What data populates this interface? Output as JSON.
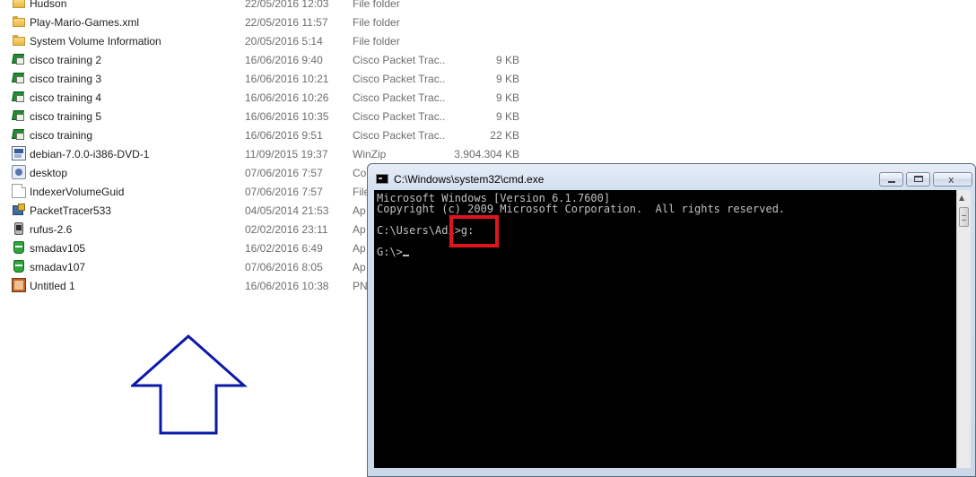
{
  "file_list": [
    {
      "name": "Hudson",
      "date": "22/05/2016 12:03",
      "type": "File folder",
      "size": "",
      "icon": "folder-icon"
    },
    {
      "name": "Play-Mario-Games.xml",
      "date": "22/05/2016 11:57",
      "type": "File folder",
      "size": "",
      "icon": "folder-icon"
    },
    {
      "name": "System Volume Information",
      "date": "20/05/2016 5:14",
      "type": "File folder",
      "size": "",
      "icon": "folder-icon"
    },
    {
      "name": "cisco training 2",
      "date": "16/06/2016 9:40",
      "type": "Cisco Packet Trac...",
      "size": "9 KB",
      "icon": "packet-tracer-file-icon"
    },
    {
      "name": "cisco training 3",
      "date": "16/06/2016 10:21",
      "type": "Cisco Packet Trac...",
      "size": "9 KB",
      "icon": "packet-tracer-file-icon"
    },
    {
      "name": "cisco training 4",
      "date": "16/06/2016 10:26",
      "type": "Cisco Packet Trac...",
      "size": "9 KB",
      "icon": "packet-tracer-file-icon"
    },
    {
      "name": "cisco training 5",
      "date": "16/06/2016 10:35",
      "type": "Cisco Packet Trac...",
      "size": "9 KB",
      "icon": "packet-tracer-file-icon"
    },
    {
      "name": "cisco training",
      "date": "16/06/2016 9:51",
      "type": "Cisco Packet Trac...",
      "size": "22 KB",
      "icon": "packet-tracer-file-icon"
    },
    {
      "name": "debian-7.0.0-i386-DVD-1",
      "date": "11/09/2015 19:37",
      "type": "WinZip",
      "size": "3.904.304 KB",
      "icon": "iso-file-icon"
    },
    {
      "name": "desktop",
      "date": "07/06/2016 7:57",
      "type": "Co",
      "size": "",
      "icon": "desktop-ini-icon"
    },
    {
      "name": "IndexerVolumeGuid",
      "date": "07/06/2016 7:57",
      "type": "File",
      "size": "",
      "icon": "blank-file-icon"
    },
    {
      "name": "PacketTracer533",
      "date": "04/05/2014 21:53",
      "type": "Ap",
      "size": "",
      "icon": "installer-icon"
    },
    {
      "name": "rufus-2.6",
      "date": "02/02/2016 23:11",
      "type": "Ap",
      "size": "",
      "icon": "usb-app-icon"
    },
    {
      "name": "smadav105",
      "date": "16/02/2016 6:49",
      "type": "Ap",
      "size": "",
      "icon": "smadav-icon"
    },
    {
      "name": "smadav107",
      "date": "07/06/2016 8:05",
      "type": "Ap",
      "size": "",
      "icon": "smadav-icon"
    },
    {
      "name": "Untitled 1",
      "date": "16/06/2016 10:38",
      "type": "PN",
      "size": "",
      "icon": "png-image-icon"
    }
  ],
  "annotation": {
    "arrow_color": "#0a1aa8",
    "highlight_color": "#e0141e"
  },
  "cmd_window": {
    "title": "C:\\Windows\\system32\\cmd.exe",
    "lines": [
      "Microsoft Windows [Version 6.1.7600]",
      "Copyright (c) 2009 Microsoft Corporation.  All rights reserved.",
      "",
      "C:\\Users\\Adi>g:",
      "",
      "G:\\>"
    ],
    "close_glyph": "x"
  }
}
